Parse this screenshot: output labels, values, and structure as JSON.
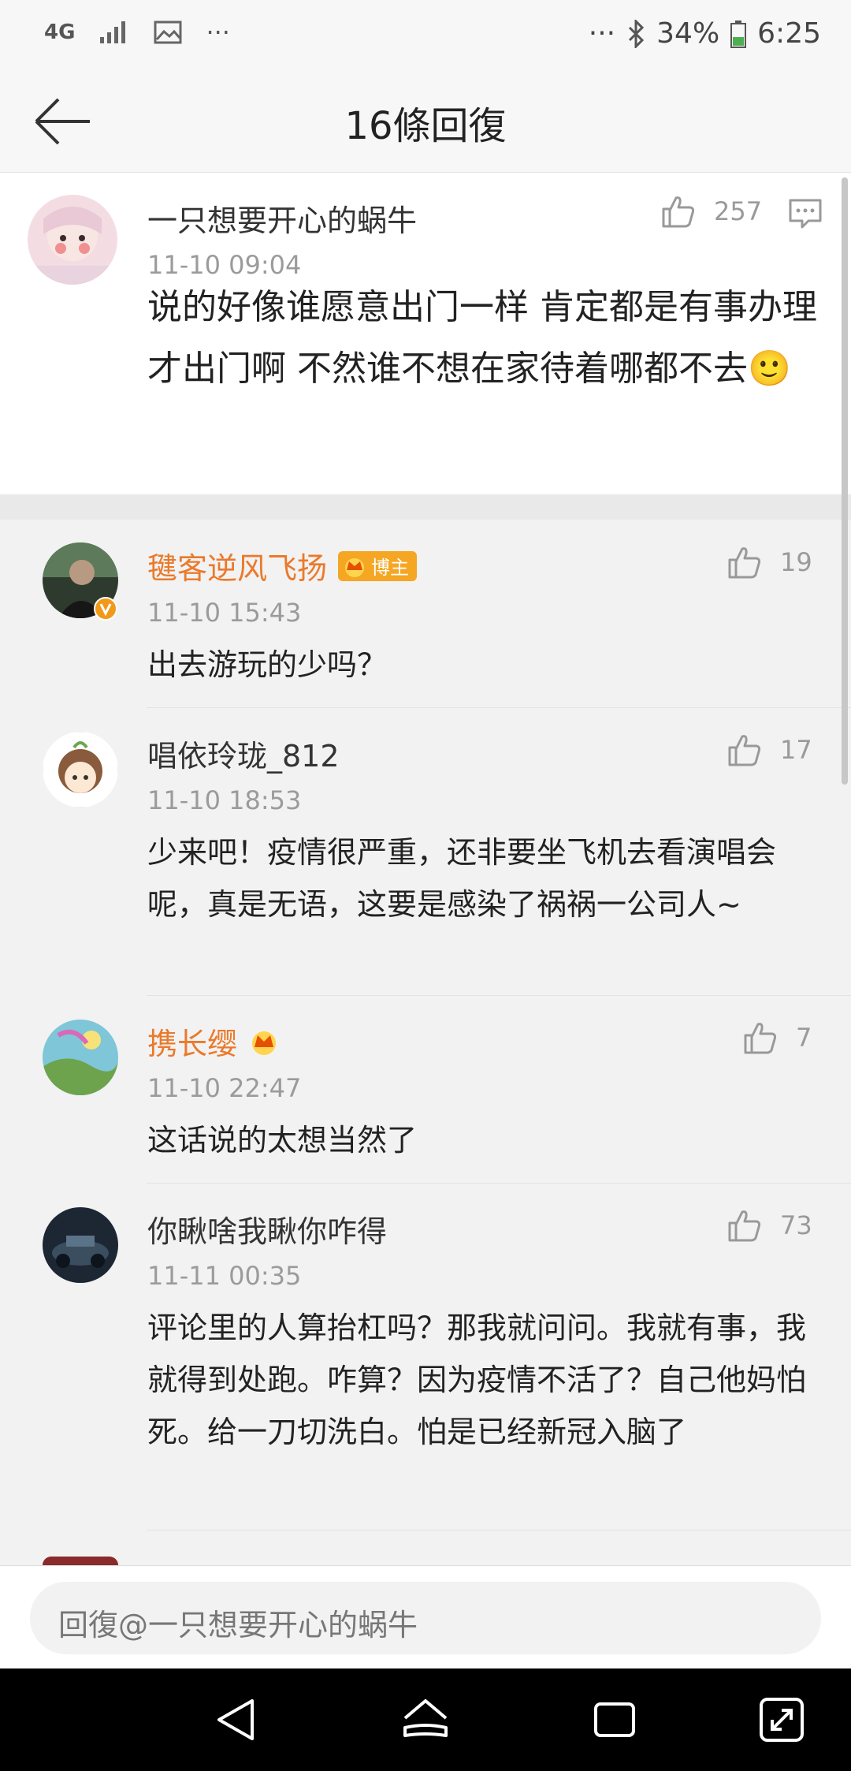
{
  "status_bar": {
    "network": "4G",
    "more_left": "···",
    "more_right": "···",
    "battery": "34%",
    "time": "6:25"
  },
  "header": {
    "title": "16條回復"
  },
  "top_comment": {
    "user": "一只想要开心的蜗牛",
    "time": "11-10 09:04",
    "likes": "257",
    "content": "说的好像谁愿意出门一样 肯定都是有事办理才出门啊 不然谁不想在家待着哪都不去🙂"
  },
  "replies": [
    {
      "user": "毽客逆风飞扬",
      "badge": "博主",
      "time": "11-10 15:43",
      "likes": "19",
      "content": "出去游玩的少吗？"
    },
    {
      "user": "唱依玲珑_812",
      "time": "11-10 18:53",
      "likes": "17",
      "content": "少来吧！疫情很严重，还非要坐飞机去看演唱会呢，真是无语，这要是感染了祸祸一公司人~"
    },
    {
      "user": "携长缨",
      "time": "11-10 22:47",
      "likes": "7",
      "content": "这话说的太想当然了"
    },
    {
      "user": "你瞅啥我瞅你咋得",
      "time": "11-11 00:35",
      "likes": "73",
      "content": "评论里的人算抬杠吗？那我就问问。我就有事，我就得到处跑。咋算？因为疫情不活了？自己他妈怕死。给一刀切洗白。怕是已经新冠入脑了"
    }
  ],
  "input": {
    "placeholder": "回復@一只想要开心的蜗牛"
  },
  "colors": {
    "vip_name": "#ea7a2c",
    "badge": "#f5a623"
  }
}
